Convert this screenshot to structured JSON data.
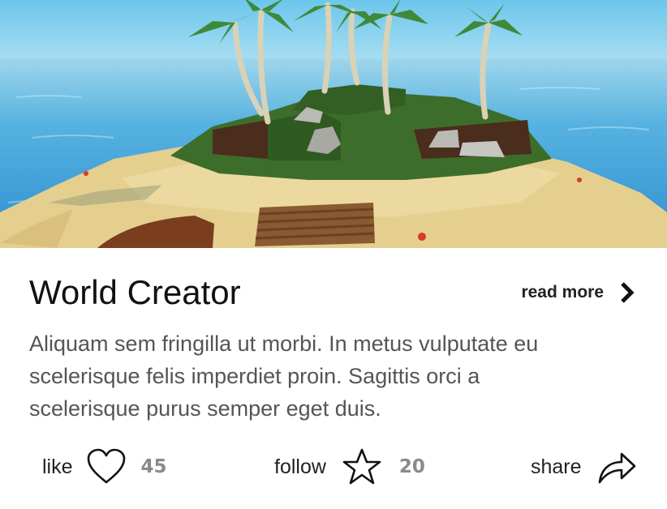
{
  "card": {
    "title": "World Creator",
    "read_more_label": "read more",
    "description": "Aliquam sem fringilla ut morbi. In metus vulputate eu scelerisque felis imperdiet proin. Sagittis orci a scelerisque purus semper eget duis."
  },
  "actions": {
    "like": {
      "label": "like",
      "count": "45",
      "icon": "heart-icon"
    },
    "follow": {
      "label": "follow",
      "count": "20",
      "icon": "star-icon"
    },
    "share": {
      "label": "share",
      "icon": "share-arrow-icon"
    }
  },
  "colors": {
    "sky": "#7fcdee",
    "sea": "#3aa0d8",
    "sand": "#e6d295",
    "grass": "#3f6f2c",
    "title_text": "#111111",
    "body_text": "#555555",
    "count_text": "#8a8a8a"
  }
}
